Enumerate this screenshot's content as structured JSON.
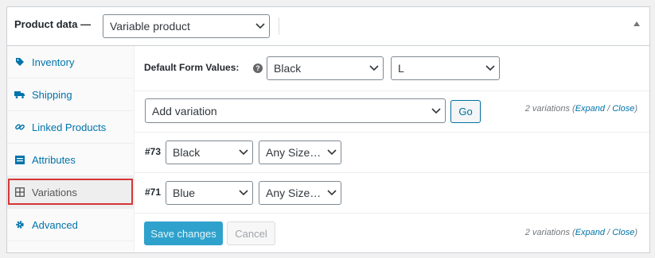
{
  "header": {
    "title": "Product data —",
    "product_type": "Variable product"
  },
  "sidebar": {
    "items": [
      {
        "label": "Inventory",
        "icon": "tag-icon"
      },
      {
        "label": "Shipping",
        "icon": "truck-icon"
      },
      {
        "label": "Linked Products",
        "icon": "link-icon"
      },
      {
        "label": "Attributes",
        "icon": "list-icon"
      },
      {
        "label": "Variations",
        "icon": "grid-icon",
        "active": true
      },
      {
        "label": "Advanced",
        "icon": "gear-icon"
      }
    ]
  },
  "defaults": {
    "label": "Default Form Values:",
    "help": "?",
    "color": "Black",
    "size": "L"
  },
  "add_variation": {
    "select": "Add variation",
    "go": "Go"
  },
  "summary": {
    "text": "2 variations (",
    "expand": "Expand",
    "sep": " / ",
    "close": "Close",
    "end": ")"
  },
  "variations": [
    {
      "id": "#73",
      "color": "Black",
      "size": "Any Size…"
    },
    {
      "id": "#71",
      "color": "Blue",
      "size": "Any Size…"
    }
  ],
  "footer": {
    "save": "Save changes",
    "cancel": "Cancel"
  },
  "colors": {
    "link": "#0073aa",
    "primary": "#2ea2cc",
    "highlight": "#d63638"
  }
}
